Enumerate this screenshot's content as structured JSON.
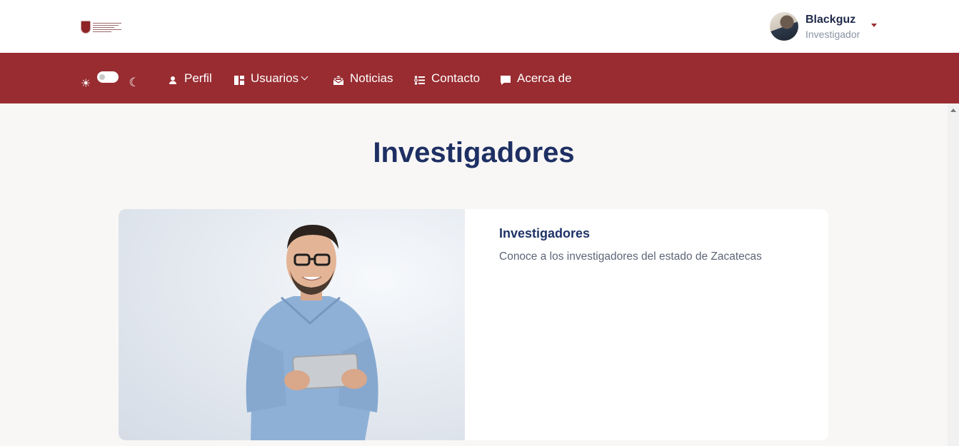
{
  "header": {
    "logo_name": "institution-logo",
    "user": {
      "name": "Blackguz",
      "role": "Investigador"
    }
  },
  "nav": {
    "items": [
      {
        "label": "Perfil",
        "icon": "person-icon"
      },
      {
        "label": "Usuarios",
        "icon": "dashboard-icon",
        "has_dropdown": true
      },
      {
        "label": "Noticias",
        "icon": "mail-open-icon"
      },
      {
        "label": "Contacto",
        "icon": "list-icon"
      },
      {
        "label": "Acerca de",
        "icon": "chat-bubble-icon"
      }
    ],
    "theme_toggle": {
      "mode": "light"
    }
  },
  "main": {
    "title": "Investigadores",
    "card": {
      "title": "Investigadores",
      "description": "Conoce a los investigadores del estado de Zacatecas",
      "image": "man-holding-tablet-photo"
    }
  },
  "colors": {
    "nav_background": "#982c31",
    "title": "#1e2f63",
    "page_background": "#f8f7f5"
  }
}
